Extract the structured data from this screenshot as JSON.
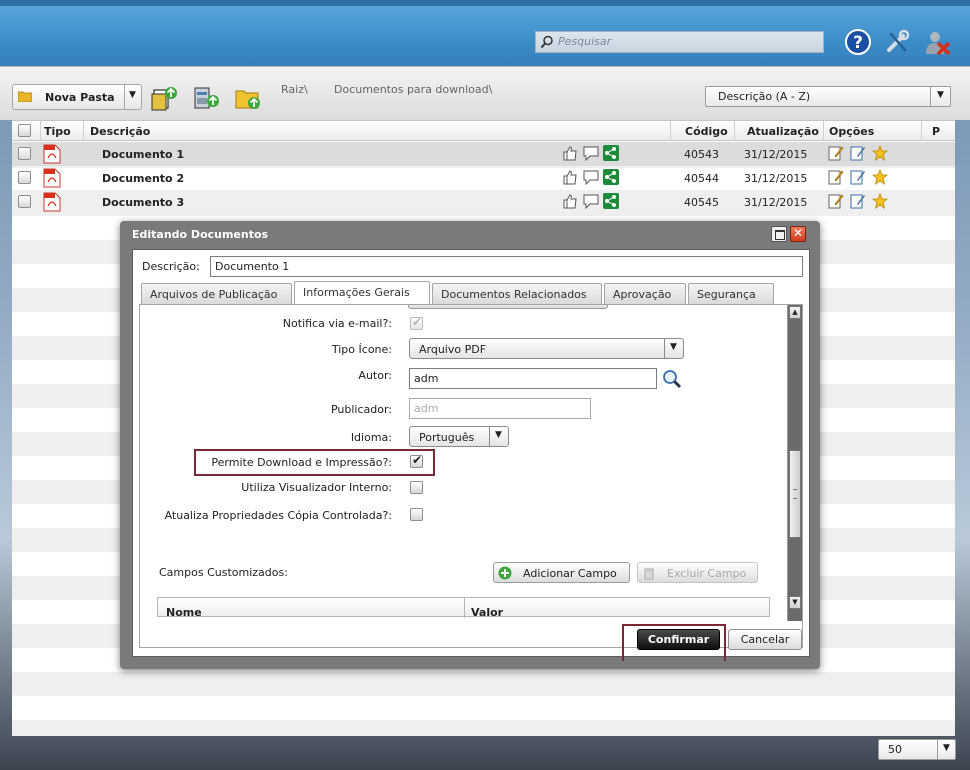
{
  "header": {
    "search_placeholder": "Pesquisar",
    "icons": [
      "help-icon",
      "tools-icon",
      "logout-icon"
    ]
  },
  "toolbar": {
    "new_folder_label": "Nova Pasta",
    "breadcrumb": [
      "Raiz\\",
      "Documentos para download\\"
    ],
    "sort_value": "Descrição (A - Z)"
  },
  "table": {
    "columns": [
      "Tipo",
      "Descrição",
      "Código",
      "Atualização",
      "Opções",
      "P"
    ],
    "rows": [
      {
        "name": "Documento 1",
        "code": "40543",
        "date": "31/12/2015"
      },
      {
        "name": "Documento 2",
        "code": "40544",
        "date": "31/12/2015"
      },
      {
        "name": "Documento 3",
        "code": "40545",
        "date": "31/12/2015"
      }
    ]
  },
  "page_size": "50",
  "modal": {
    "title": "Editando Documentos",
    "desc_label": "Descrição:",
    "desc_value": "Documento 1",
    "tabs": [
      "Arquivos de Publicação",
      "Informações Gerais",
      "Documentos Relacionados",
      "Aprovação",
      "Segurança"
    ],
    "active_tab": "Informações Gerais",
    "fields": {
      "notify_label": "Notifica via e-mail?:",
      "icon_type_label": "Tipo Ícone:",
      "icon_type_value": "Arquivo PDF",
      "author_label": "Autor:",
      "author_value": "adm",
      "publisher_label": "Publicador:",
      "publisher_value": "adm",
      "language_label": "Idioma:",
      "language_value": "Português",
      "allow_download_label": "Permite Download e Impressão?:",
      "internal_viewer_label": "Utiliza Visualizador Interno:",
      "update_props_label": "Atualiza Propriedades Cópia Controlada?:",
      "custom_fields_label": "Campos Customizados:",
      "add_field_label": "Adicionar Campo",
      "delete_field_label": "Excluir Campo",
      "col_name": "Nome",
      "col_value": "Valor"
    },
    "confirm_label": "Confirmar",
    "cancel_label": "Cancelar"
  },
  "colors": {
    "header_blue": "#3c8cc8",
    "highlight_border": "#7b2736",
    "confirm_bg": "#1a1a1a"
  }
}
